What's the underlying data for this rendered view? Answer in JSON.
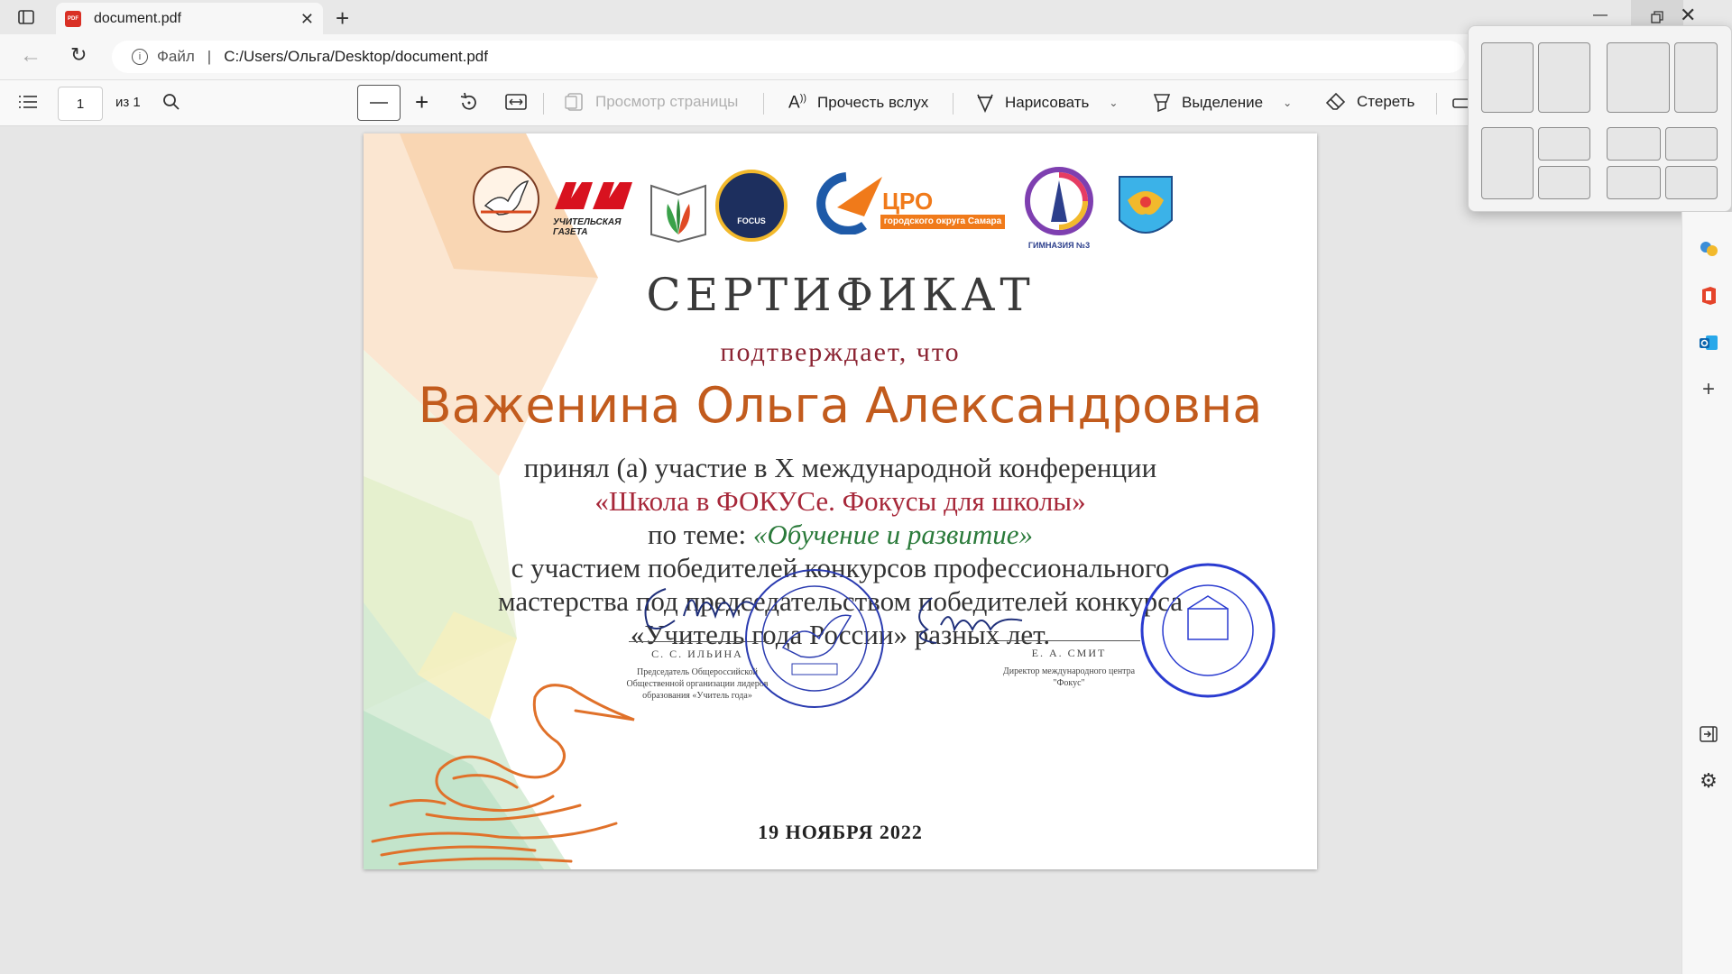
{
  "browser": {
    "tab_title": "document.pdf",
    "site_label": "Файл",
    "url": "C:/Users/Ольга/Desktop/document.pdf"
  },
  "pdf_toolbar": {
    "page_number": "1",
    "page_total": "из 1",
    "page_view": "Просмотр страницы",
    "read_aloud": "Прочесть вслух",
    "draw": "Нарисовать",
    "highlight": "Выделение",
    "erase": "Стереть"
  },
  "certificate": {
    "logos": {
      "newspaper": "УЧИТЕЛЬСКАЯ ГАЗЕТА",
      "tsro": "ЦРО",
      "tsro_sub": "городского округа Самара",
      "gymnasium": "ГИМНАЗИЯ №3",
      "focus": "FOCUS"
    },
    "title": "СЕРТИФИКАТ",
    "confirm": "подтверждает, что",
    "name": "Важенина Ольга Александровна",
    "line1": "принял (а) участие в X международной конференции",
    "line2": "«Школа в ФОКУСе. Фокусы для школы»",
    "line3_prefix": "по теме: ",
    "line3_topic": "«Обучение и развитие»",
    "line4": "с участием победителей конкурсов профессионального",
    "line5": "мастерства под председательством победителей конкурса",
    "line6": "«Учитель года России» разных лет.",
    "signer1_name": "С. С. ИЛЬИНА",
    "signer1_role1": "Председатель Общероссийской",
    "signer1_role2": "Общественной организации лидеров",
    "signer1_role3": "образования «Учитель года»",
    "signer2_name": "Е. А. СМИТ",
    "signer2_role1": "Директор международного центра",
    "signer2_role2": "\"Фокус\"",
    "date": "19 НОЯБРЯ 2022"
  }
}
